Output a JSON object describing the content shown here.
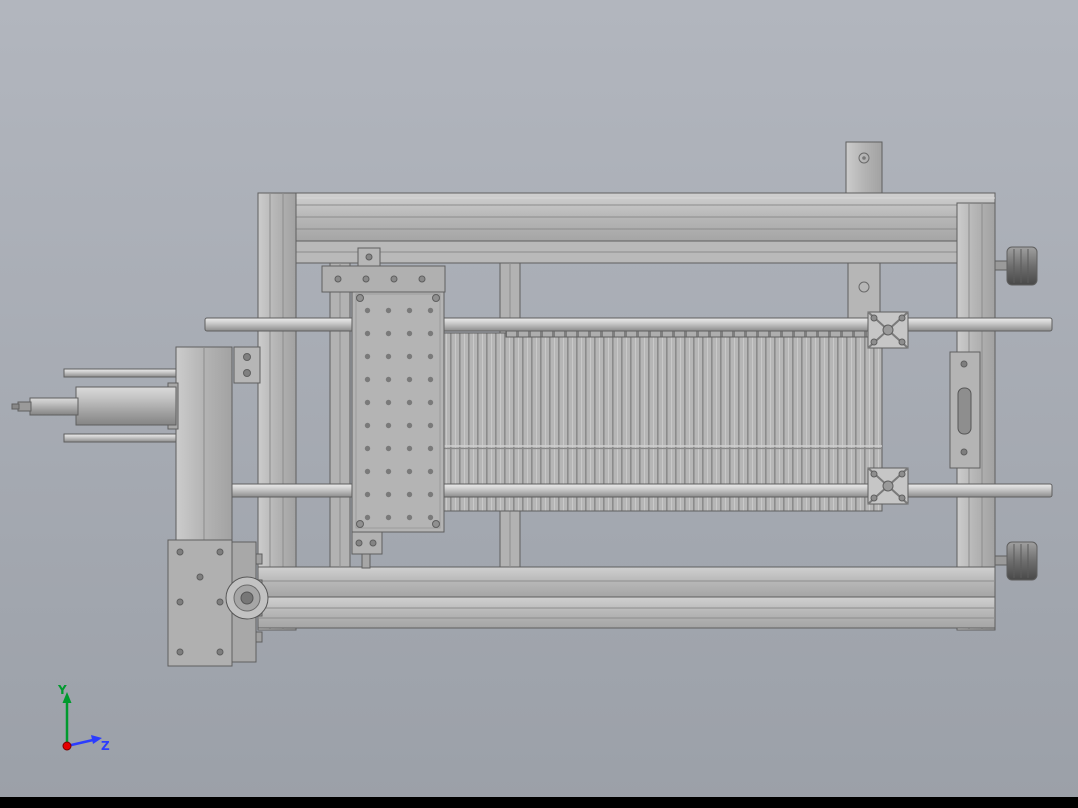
{
  "triad": {
    "y_label": "Y",
    "z_label": "Z"
  },
  "colors": {
    "bg_top": "#b2b6be",
    "bg_bottom": "#9ba0a8",
    "bottom_bar": "#000000",
    "axis_y": "#009a2e",
    "axis_z": "#2b3cff",
    "origin_dot": "#e60000",
    "metal_light": "#d2d2d2",
    "metal_mid": "#b6b6b6",
    "metal_dark": "#8a8a8a",
    "outline": "#5f5f5f"
  }
}
